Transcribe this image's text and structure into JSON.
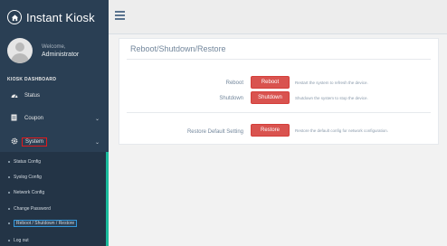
{
  "app": {
    "title": "Instant Kiosk"
  },
  "profile": {
    "welcome": "Welcome,",
    "name": "Administrator"
  },
  "sidebar": {
    "section_title": "KIOSK DASHBOARD",
    "items": [
      {
        "label": "Status",
        "icon": "dashboard-icon"
      },
      {
        "label": "Coupon",
        "icon": "coupon-icon"
      },
      {
        "label": "System",
        "icon": "gear-icon"
      }
    ],
    "submenu": [
      {
        "label": "Status Config"
      },
      {
        "label": "Syslog Config"
      },
      {
        "label": "Network Config"
      },
      {
        "label": "Change Password"
      },
      {
        "label": "Reboot / Shutdown / Restore"
      },
      {
        "label": "Log out"
      }
    ]
  },
  "page": {
    "title": "Reboot/Shutdown/Restore",
    "rows": [
      {
        "label": "Reboot",
        "button": "Reboot",
        "description": "Restart the system to refresh the device."
      },
      {
        "label": "Shutdown",
        "button": "Shutdown",
        "description": "Shutdown the system to stop the device."
      },
      {
        "label": "Restore Default Setting",
        "button": "Restore",
        "description": "Restore the default config for network configuration."
      }
    ]
  },
  "colors": {
    "sidebar": "#2a3f54",
    "danger": "#d9534f",
    "accent": "#1abb9c",
    "highlight": "#e31a1c"
  }
}
